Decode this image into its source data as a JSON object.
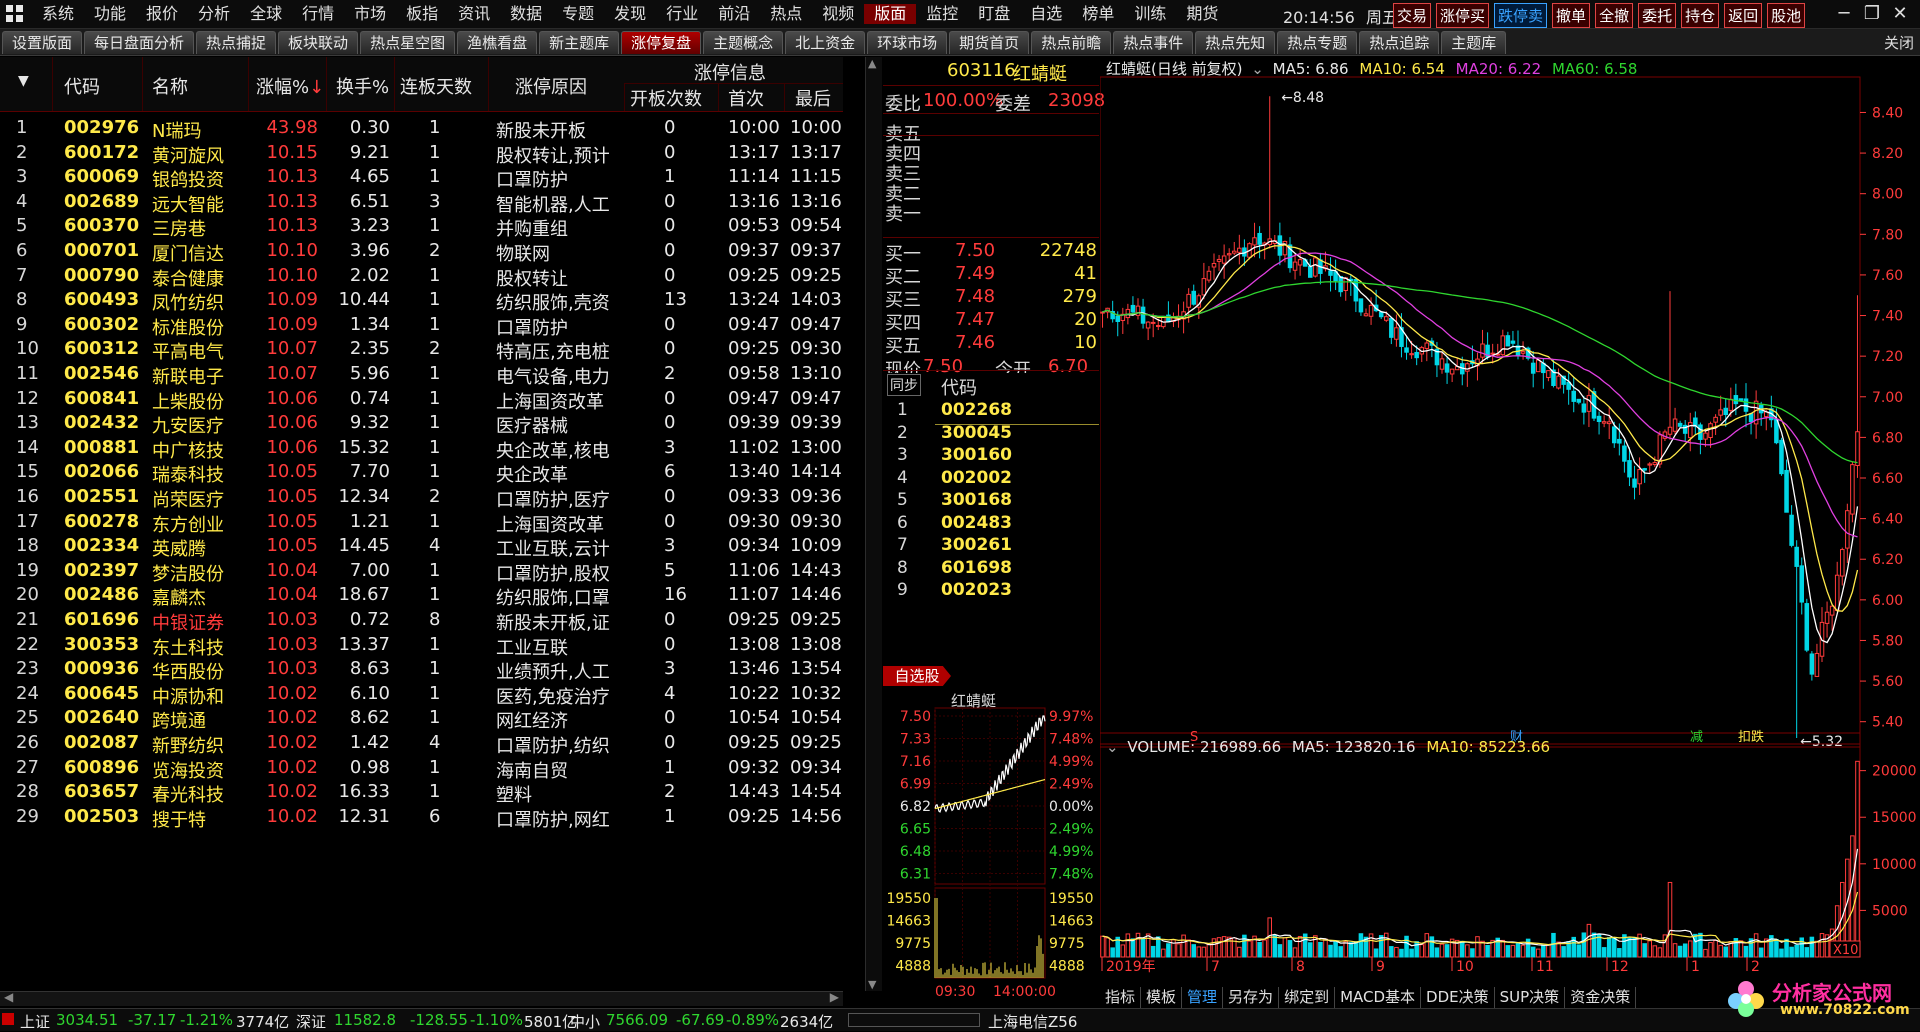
{
  "menubar": {
    "items": [
      "系统",
      "功能",
      "报价",
      "分析",
      "全球",
      "行情",
      "市场",
      "板指",
      "资讯",
      "数据",
      "专题",
      "发现",
      "行业",
      "前沿",
      "热点",
      "视频",
      "版面",
      "监控",
      "盯盘",
      "自选",
      "榜单",
      "训练",
      "期货"
    ],
    "active": "版面",
    "time": "20:14:56",
    "weekday": "周五",
    "quick": [
      "交易",
      "涨停买",
      "跌停卖",
      "撤单",
      "全撤",
      "委托",
      "持仓",
      "返回",
      "股池"
    ],
    "quick_blue": [
      "跌停卖"
    ],
    "window_buttons": [
      "─",
      "❐",
      "✕"
    ]
  },
  "tabs": {
    "items": [
      "设置版面",
      "每日盘面分析",
      "热点捕捉",
      "板块联动",
      "热点星空图",
      "渔樵看盘",
      "新主题库",
      "涨停复盘",
      "主题概念",
      "北上资金",
      "环球市场",
      "期货首页",
      "热点前瞻",
      "热点事件",
      "热点先知",
      "热点专题",
      "热点追踪",
      "主题库"
    ],
    "active": "涨停复盘",
    "close": "关闭"
  },
  "list": {
    "headers": {
      "sort": "▼",
      "code": "代码",
      "name": "名称",
      "pct": "涨幅%",
      "pct_arrow": "↓",
      "turnover": "换手%",
      "days": "连板天数",
      "reason": "涨停原因",
      "info": "涨停信息",
      "opens": "开板次数",
      "first": "首次",
      "last": "最后"
    },
    "rows": [
      [
        "1",
        "002976",
        "N瑞玛",
        "43.98",
        "0.30",
        "1",
        "新股未开板",
        "0",
        "10:00",
        "10:00"
      ],
      [
        "2",
        "600172",
        "黄河旋风",
        "10.15",
        "9.21",
        "1",
        "股权转让,预计",
        "0",
        "13:17",
        "13:17"
      ],
      [
        "3",
        "600069",
        "银鸽投资",
        "10.13",
        "4.65",
        "1",
        "口罩防护",
        "1",
        "11:14",
        "11:15"
      ],
      [
        "4",
        "002689",
        "远大智能",
        "10.13",
        "6.51",
        "3",
        "智能机器,人工",
        "0",
        "13:16",
        "13:16"
      ],
      [
        "5",
        "600370",
        "三房巷",
        "10.13",
        "3.23",
        "1",
        "并购重组",
        "0",
        "09:53",
        "09:54"
      ],
      [
        "6",
        "000701",
        "厦门信达",
        "10.10",
        "3.96",
        "2",
        "物联网",
        "0",
        "09:37",
        "09:37"
      ],
      [
        "7",
        "000790",
        "泰合健康",
        "10.10",
        "2.02",
        "1",
        "股权转让",
        "0",
        "09:25",
        "09:25"
      ],
      [
        "8",
        "600493",
        "凤竹纺织",
        "10.09",
        "10.44",
        "1",
        "纺织服饰,壳资",
        "13",
        "13:24",
        "14:03"
      ],
      [
        "9",
        "600302",
        "标准股份",
        "10.09",
        "1.34",
        "1",
        "口罩防护",
        "0",
        "09:47",
        "09:47"
      ],
      [
        "10",
        "600312",
        "平高电气",
        "10.07",
        "2.35",
        "2",
        "特高压,充电桩",
        "0",
        "09:25",
        "09:30"
      ],
      [
        "11",
        "002546",
        "新联电子",
        "10.07",
        "5.96",
        "1",
        "电气设备,电力",
        "2",
        "09:58",
        "13:10"
      ],
      [
        "12",
        "600841",
        "上柴股份",
        "10.06",
        "0.74",
        "1",
        "上海国资改革",
        "0",
        "09:47",
        "09:47"
      ],
      [
        "13",
        "002432",
        "九安医疗",
        "10.06",
        "9.32",
        "1",
        "医疗器械",
        "0",
        "09:39",
        "09:39"
      ],
      [
        "14",
        "000881",
        "中广核技",
        "10.06",
        "15.32",
        "1",
        "央企改革,核电",
        "3",
        "11:02",
        "13:00"
      ],
      [
        "15",
        "002066",
        "瑞泰科技",
        "10.05",
        "7.70",
        "1",
        "央企改革",
        "6",
        "13:40",
        "14:14"
      ],
      [
        "16",
        "002551",
        "尚荣医疗",
        "10.05",
        "12.34",
        "2",
        "口罩防护,医疗",
        "0",
        "09:33",
        "09:36"
      ],
      [
        "17",
        "600278",
        "东方创业",
        "10.05",
        "1.21",
        "1",
        "上海国资改革",
        "0",
        "09:30",
        "09:30"
      ],
      [
        "18",
        "002334",
        "英威腾",
        "10.05",
        "14.45",
        "4",
        "工业互联,云计",
        "3",
        "09:34",
        "10:09"
      ],
      [
        "19",
        "002397",
        "梦洁股份",
        "10.04",
        "7.00",
        "1",
        "口罩防护,股权",
        "5",
        "11:06",
        "14:43"
      ],
      [
        "20",
        "002486",
        "嘉麟杰",
        "10.04",
        "18.67",
        "1",
        "纺织服饰,口罩",
        "16",
        "11:07",
        "14:46"
      ],
      [
        "21",
        "601696",
        "中银证券",
        "10.03",
        "0.72",
        "8",
        "新股未开板,证",
        "0",
        "09:25",
        "09:25"
      ],
      [
        "22",
        "300353",
        "东土科技",
        "10.03",
        "13.37",
        "1",
        "工业互联",
        "0",
        "13:08",
        "13:08"
      ],
      [
        "23",
        "000936",
        "华西股份",
        "10.03",
        "8.63",
        "1",
        "业绩预升,人工",
        "3",
        "13:46",
        "13:54"
      ],
      [
        "24",
        "600645",
        "中源协和",
        "10.02",
        "6.10",
        "1",
        "医药,免疫治疗",
        "4",
        "10:22",
        "10:32"
      ],
      [
        "25",
        "002640",
        "跨境通",
        "10.02",
        "8.62",
        "1",
        "网红经济",
        "0",
        "10:54",
        "10:54"
      ],
      [
        "26",
        "002087",
        "新野纺织",
        "10.02",
        "1.42",
        "4",
        "口罩防护,纺织",
        "0",
        "09:25",
        "09:25"
      ],
      [
        "27",
        "600896",
        "览海投资",
        "10.02",
        "0.98",
        "1",
        "海南自贸",
        "1",
        "09:32",
        "09:34"
      ],
      [
        "28",
        "603657",
        "春光科技",
        "10.02",
        "16.33",
        "1",
        "塑料",
        "2",
        "14:43",
        "14:54"
      ],
      [
        "29",
        "002503",
        "搜于特",
        "10.02",
        "12.31",
        "6",
        "口罩防护,网红",
        "1",
        "09:25",
        "14:56"
      ]
    ],
    "highlight_name_row": 21
  },
  "book": {
    "code": "603116",
    "name": "红蜻蜓",
    "ratio_label": "委比",
    "ratio": "100.00%",
    "diff_label": "委差",
    "diff": "23098",
    "sells": [
      "卖五",
      "卖四",
      "卖三",
      "卖二",
      "卖一"
    ],
    "buys": [
      {
        "label": "买一",
        "price": "7.50",
        "vol": "22748"
      },
      {
        "label": "买二",
        "price": "7.49",
        "vol": "41"
      },
      {
        "label": "买三",
        "price": "7.48",
        "vol": "279"
      },
      {
        "label": "买四",
        "price": "7.47",
        "vol": "20"
      },
      {
        "label": "买五",
        "price": "7.46",
        "vol": "10"
      }
    ],
    "last_label": "现价",
    "last_price": "7.50",
    "open_label": "今开",
    "open_price": "6.70"
  },
  "sync": {
    "button": "同步",
    "header": "代码",
    "rows": [
      [
        "1",
        "002268"
      ],
      [
        "2",
        "300045"
      ],
      [
        "3",
        "300160"
      ],
      [
        "4",
        "002002"
      ],
      [
        "5",
        "300168"
      ],
      [
        "6",
        "002483"
      ],
      [
        "7",
        "300261"
      ],
      [
        "8",
        "601698"
      ],
      [
        "9",
        "002023"
      ]
    ]
  },
  "mini": {
    "tag": "自选股",
    "name": "红蜻蜓",
    "left_prices": [
      "7.50",
      "7.33",
      "7.16",
      "6.99",
      "6.82",
      "6.65",
      "6.48",
      "6.31"
    ],
    "right_pcts": [
      "9.97%",
      "7.48%",
      "4.99%",
      "2.49%",
      "0.00%",
      "2.49%",
      "4.99%",
      "7.48%"
    ],
    "vol_left": [
      "19550",
      "14663",
      "9775",
      "4888"
    ],
    "vol_right": [
      "19550",
      "14663",
      "9775",
      "4888"
    ],
    "time_start": "09:30",
    "time_mid": "14:00:00"
  },
  "kchart": {
    "title": "红蜻蜓(日线 前复权)",
    "ma5": "MA5: 6.86",
    "ma10": "MA10: 6.54",
    "ma20": "MA20: 6.22",
    "ma60": "MA60: 6.58",
    "high_mark": "8.48",
    "low_mark": "5.32",
    "y_ticks": [
      "8.40",
      "8.20",
      "8.00",
      "7.80",
      "7.60",
      "7.40",
      "7.20",
      "7.00",
      "6.80",
      "6.60",
      "6.40",
      "6.20",
      "6.00",
      "5.80",
      "5.60",
      "5.40"
    ],
    "markers": [
      {
        "t": "S",
        "c": "#ff3b3b"
      },
      {
        "t": "财",
        "c": "#39a2ff"
      },
      {
        "t": "减",
        "c": "#2fd62f"
      },
      {
        "t": "扣跌",
        "c": "#ffe94a"
      }
    ],
    "volume": "VOLUME: 216989.66",
    "vma5": "MA5: 123820.16",
    "vma10": "MA10: 85223.66",
    "vol_ticks": [
      "20000",
      "15000",
      "10000",
      "5000"
    ],
    "unit": "X10",
    "x_labels": [
      "2019年",
      "7",
      "8",
      "9",
      "10",
      "11",
      "12",
      "1",
      "2"
    ]
  },
  "tooltabs": {
    "items": [
      "指标",
      "模板",
      "管理",
      "另存为",
      "绑定到",
      "MACD基本",
      "DDE决策",
      "SUP决策",
      "资金决策"
    ],
    "active": "管理"
  },
  "status": {
    "sh_label": "上证",
    "sh_val": "3034.51",
    "sh_chg": "-37.17",
    "sh_pct": "-1.21%",
    "sh_amt": "3774亿",
    "sz_label": "深证",
    "sz_val": "11582.8",
    "sz_chg": "-128.55",
    "sz_pct": "-1.10%",
    "sz_amt": "5801亿",
    "zx_label": "中小",
    "zx_val": "7566.09",
    "zx_chg": "-67.69",
    "zx_pct": "-0.89%",
    "zx_amt": "2634亿",
    "server": "上海电信Z56"
  },
  "watermark": {
    "brand": "分析家公式网",
    "url": "www.70822.com"
  }
}
